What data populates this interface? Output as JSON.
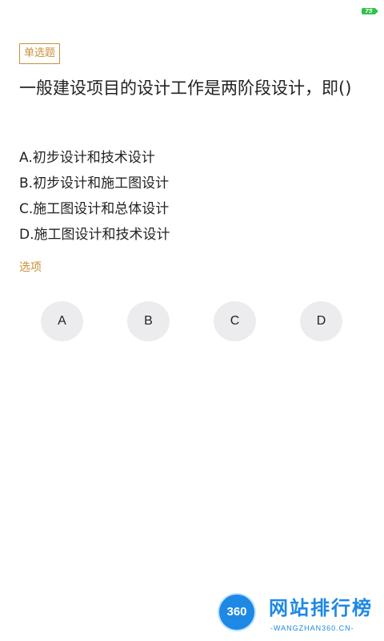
{
  "status_bar": {
    "battery_level": "75",
    "battery_color": "#2ec24a"
  },
  "question": {
    "type_tag": "单选题",
    "text": "一般建设项目的设计工作是两阶段设计，即()",
    "options": [
      "A.初步设计和技术设计",
      "B.初步设计和施工图设计",
      "C.施工图设计和总体设计",
      "D.施工图设计和技术设计"
    ]
  },
  "answer_section": {
    "label": "选项",
    "choices": [
      "A",
      "B",
      "C",
      "D"
    ]
  },
  "watermark": {
    "badge": "360",
    "title": "网站排行榜",
    "subtitle": "-WANGZHAN360.CN-"
  },
  "colors": {
    "accent": "#c9913a",
    "choice_bg": "#ececee",
    "watermark_blue": "#1e88e5"
  }
}
